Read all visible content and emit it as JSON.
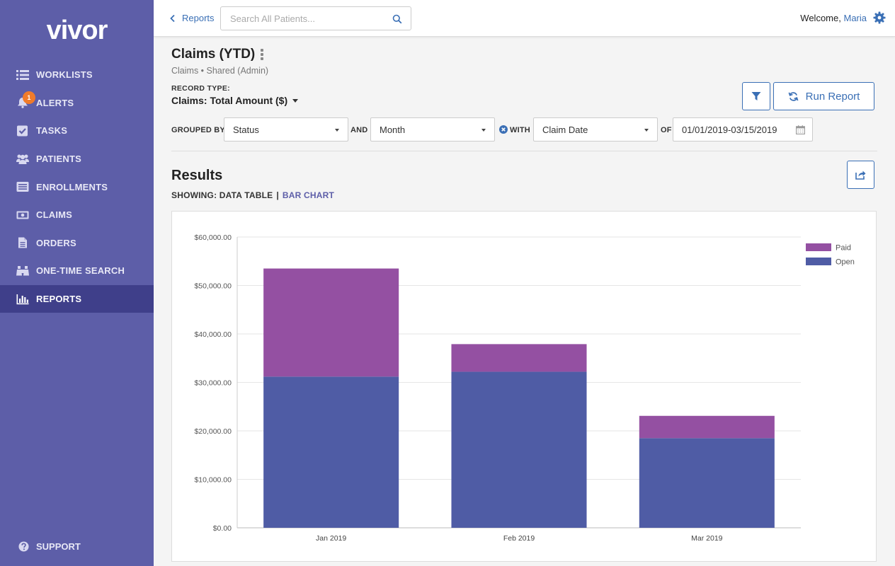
{
  "app": {
    "logo": "vivor"
  },
  "sidebar": {
    "items": [
      {
        "label": "WORKLISTS",
        "icon": "list-icon"
      },
      {
        "label": "ALERTS",
        "icon": "bell-icon",
        "badge": "1"
      },
      {
        "label": "TASKS",
        "icon": "checkbox-icon"
      },
      {
        "label": "PATIENTS",
        "icon": "users-icon"
      },
      {
        "label": "ENROLLMENTS",
        "icon": "card-list-icon"
      },
      {
        "label": "CLAIMS",
        "icon": "money-icon"
      },
      {
        "label": "ORDERS",
        "icon": "document-icon"
      },
      {
        "label": "ONE-TIME SEARCH",
        "icon": "binoculars-icon"
      },
      {
        "label": "REPORTS",
        "icon": "bar-chart-icon",
        "active": true
      }
    ],
    "support_label": "SUPPORT"
  },
  "topbar": {
    "back_label": "Reports",
    "search_placeholder": "Search All Patients...",
    "welcome_prefix": "Welcome,",
    "user_name": "Maria"
  },
  "report": {
    "title": "Claims (YTD)",
    "subtitle": "Claims • Shared (Admin)",
    "record_type_label": "RECORD TYPE:",
    "record_type_value": "Claims: Total Amount ($)",
    "run_label": "Run Report",
    "grouped_by_label": "GROUPED BY",
    "grouped_by_value": "Status",
    "and_label": "AND",
    "and_value": "Month",
    "with_label": "WITH",
    "with_value": "Claim Date",
    "of_label": "OF",
    "date_range": "01/01/2019-03/15/2019"
  },
  "results": {
    "title": "Results",
    "showing_label": "SHOWING: DATA TABLE",
    "separator": "|",
    "bar_chart_link": "BAR CHART"
  },
  "chart_data": {
    "type": "bar",
    "stacked": true,
    "categories": [
      "Jan 2019",
      "Feb 2019",
      "Mar 2019"
    ],
    "series": [
      {
        "name": "Open",
        "values": [
          31200,
          32200,
          18500
        ],
        "color": "#4f5ca5"
      },
      {
        "name": "Paid",
        "values": [
          22300,
          5700,
          4600
        ],
        "color": "#9450a2"
      }
    ],
    "ylim": [
      0,
      60000
    ],
    "yticks": [
      "$0.00",
      "$10,000.00",
      "$20,000.00",
      "$30,000.00",
      "$40,000.00",
      "$50,000.00",
      "$60,000.00"
    ],
    "legend": "top-right",
    "legend_order": [
      "Paid",
      "Open"
    ],
    "grid": true
  }
}
